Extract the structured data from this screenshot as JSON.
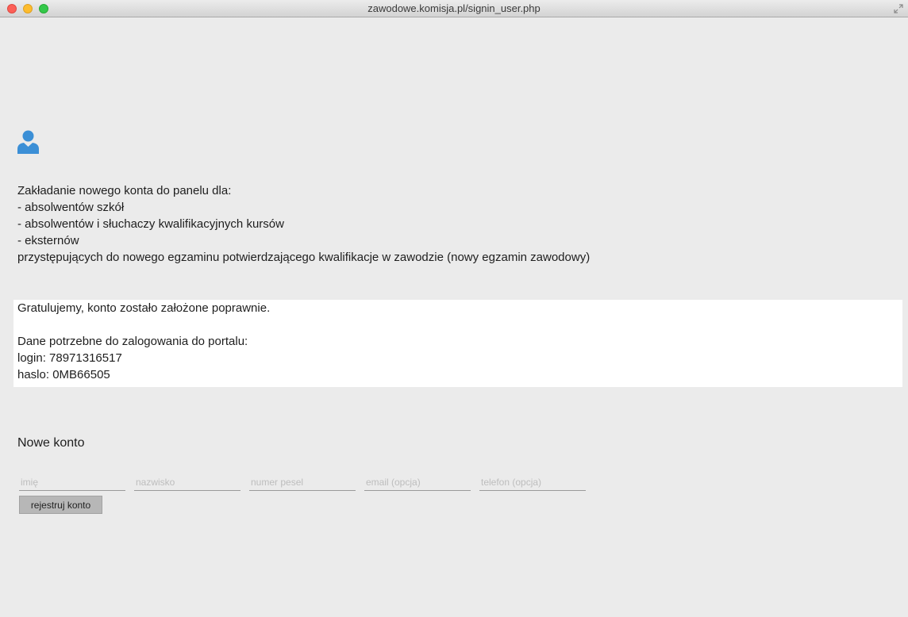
{
  "window": {
    "title": "zawodowe.komisja.pl/signin_user.php"
  },
  "icons": {
    "user": "user-icon",
    "resize": "fullscreen-icon"
  },
  "intro": {
    "line1": "Zakładanie nowego konta do panelu dla:",
    "line2": "- absolwentów szkół",
    "line3": "- absolwentów i słuchaczy kwalifikacyjnych kursów",
    "line4": "- eksternów",
    "line5": "przystępujących do nowego egzaminu potwierdzającego kwalifikacje w zawodzie (nowy egzamin zawodowy)"
  },
  "success": {
    "message": "Gratulujemy, konto zostało założone poprawnie.",
    "credentials_heading": "Dane potrzebne do zalogowania do portalu:",
    "login": "login: 78971316517",
    "password": "haslo: 0MB66505"
  },
  "form": {
    "title": "Nowe konto",
    "first_name_placeholder": "imię",
    "last_name_placeholder": "nazwisko",
    "pesel_placeholder": "numer pesel",
    "email_placeholder": "email (opcja)",
    "phone_placeholder": "telefon (opcja)",
    "submit_label": "rejestruj konto"
  },
  "colors": {
    "background": "#ebebeb",
    "accent_icon": "#3b8fd6",
    "success_box": "#ffffff",
    "button": "#b7b7b7"
  }
}
